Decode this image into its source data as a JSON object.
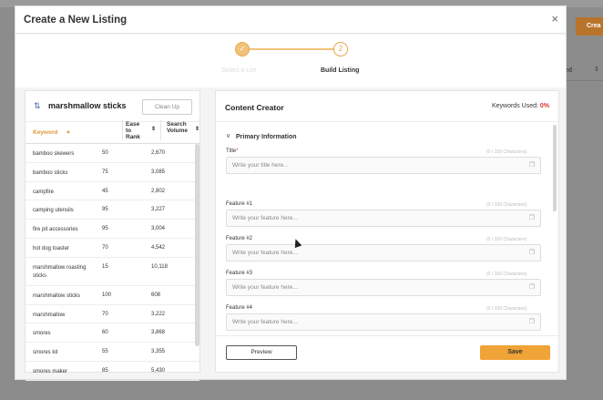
{
  "background": {
    "create_button": "Crea",
    "column_header": "ed",
    "sort_icon": "sort-icon"
  },
  "modal": {
    "title": "Create a New Listing",
    "close": "×"
  },
  "stepper": {
    "steps": [
      {
        "number": "✓",
        "label": "Select a List"
      },
      {
        "number": "2",
        "label": "Build Listing"
      }
    ]
  },
  "keywords_panel": {
    "search_term": "marshmallow sticks",
    "clean_up_label": "Clean Up",
    "columns": {
      "keyword": "Keyword",
      "ease": "Ease to Rank",
      "volume": "Search Volume"
    },
    "rows": [
      {
        "keyword": "bamboo skewers",
        "ease": "50",
        "volume": "2,670"
      },
      {
        "keyword": "bamboo sticks",
        "ease": "75",
        "volume": "3,085"
      },
      {
        "keyword": "campfire",
        "ease": "45",
        "volume": "2,802"
      },
      {
        "keyword": "camping utensils",
        "ease": "95",
        "volume": "3,227"
      },
      {
        "keyword": "fire pit accessories",
        "ease": "95",
        "volume": "3,004"
      },
      {
        "keyword": "hot dog toaster",
        "ease": "70",
        "volume": "4,542"
      },
      {
        "keyword": "marshmallow roasting sticks",
        "ease": "15",
        "volume": "10,118"
      },
      {
        "keyword": "marshmallow sticks",
        "ease": "100",
        "volume": "608"
      },
      {
        "keyword": "marshmallow",
        "ease": "70",
        "volume": "3,222"
      },
      {
        "keyword": "smores",
        "ease": "60",
        "volume": "3,868"
      },
      {
        "keyword": "smores kit",
        "ease": "55",
        "volume": "3,355"
      },
      {
        "keyword": "smores maker",
        "ease": "85",
        "volume": "5,430"
      }
    ]
  },
  "content_creator": {
    "title": "Content Creator",
    "keywords_used_label": "Keywords Used:",
    "keywords_used_value": "0%",
    "section_label": "Primary Information",
    "title_field": {
      "label": "Title",
      "count": "(0 / 150 Characters)",
      "placeholder": "Write your title here..."
    },
    "features": [
      {
        "label": "Feature #1",
        "count": "(0 / 100 Characters)",
        "placeholder": "Write your feature here..."
      },
      {
        "label": "Feature #2",
        "count": "(0 / 100 Characters)",
        "placeholder": "Write your feature here..."
      },
      {
        "label": "Feature #3",
        "count": "(0 / 100 Characters)",
        "placeholder": "Write your feature here..."
      },
      {
        "label": "Feature #4",
        "count": "(0 / 100 Characters)",
        "placeholder": "Write your feature here..."
      }
    ],
    "preview_label": "Preview",
    "save_label": "Save"
  },
  "colors": {
    "accent": "#f0a336",
    "error": "#d9342b"
  }
}
